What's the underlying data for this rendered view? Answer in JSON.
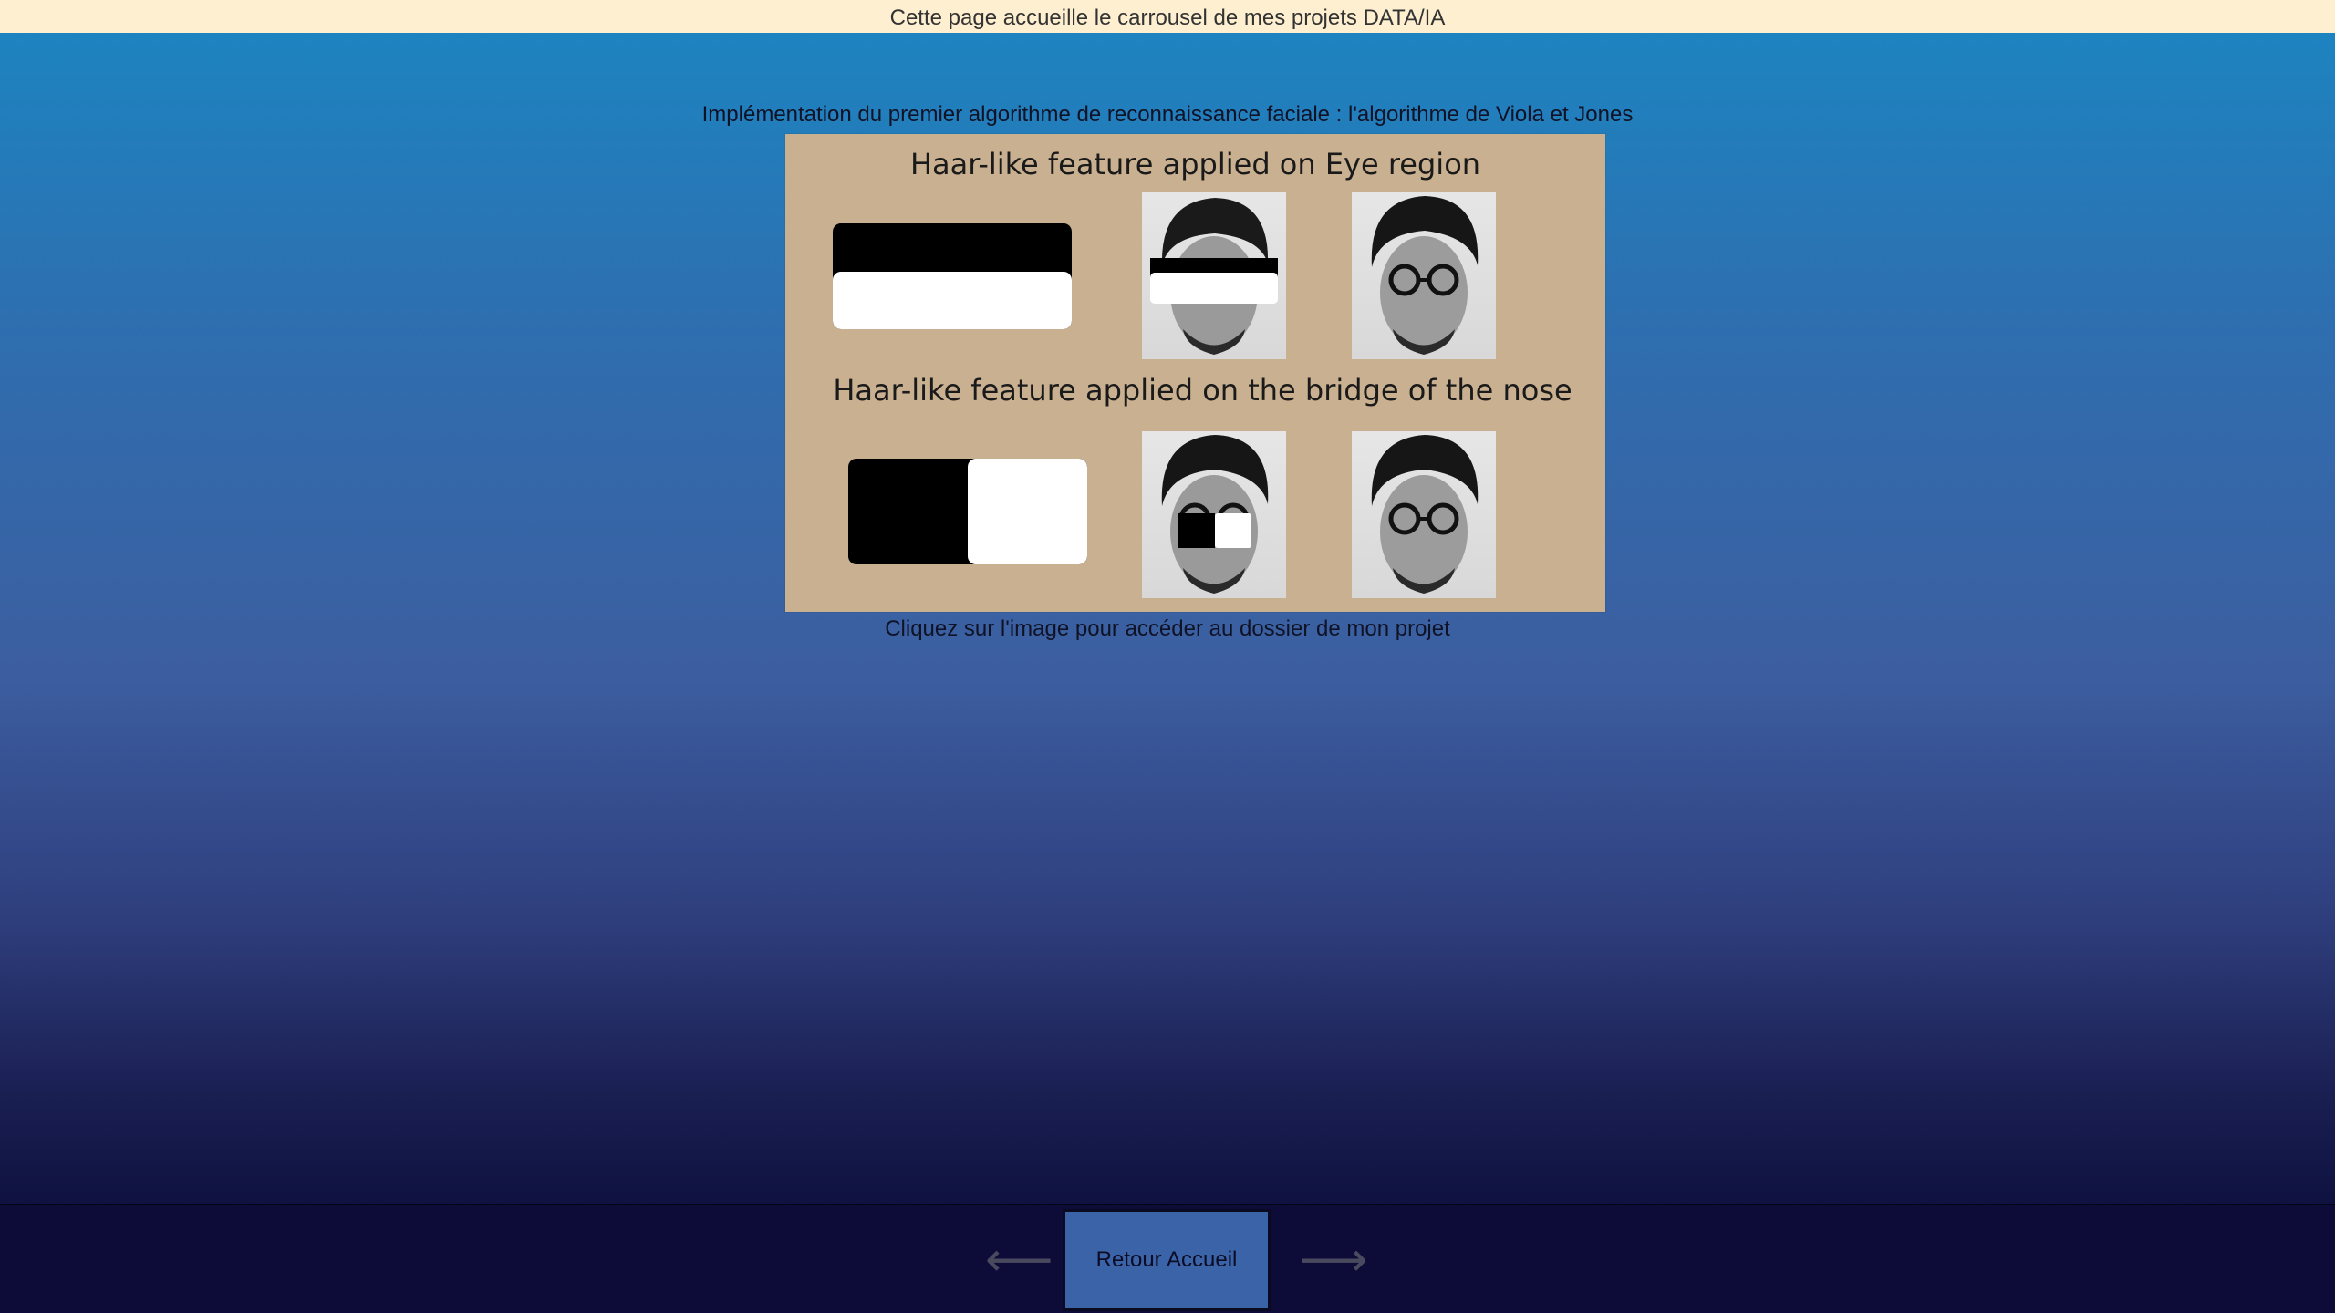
{
  "header": {
    "banner_text": "Cette page accueille le carrousel de mes projets DATA/IA"
  },
  "carousel": {
    "project_title": "Implémentation du premier algorithme de reconnaissance faciale : l'algorithme de Viola et Jones",
    "image": {
      "heading_eye": "Haar-like feature applied on Eye region",
      "heading_nose": "Haar-like feature applied on the bridge of the nose"
    },
    "caption": "Cliquez sur l'image pour accéder au dossier de mon projet"
  },
  "footer": {
    "prev_arrow": "⟵",
    "next_arrow": "⟶",
    "home_button_label": "Retour Accueil"
  },
  "colors": {
    "banner_bg": "#fdefcf",
    "image_bg": "#c9b090",
    "footer_bg": "#0d0b38",
    "home_button_bg": "#3b63a8"
  }
}
